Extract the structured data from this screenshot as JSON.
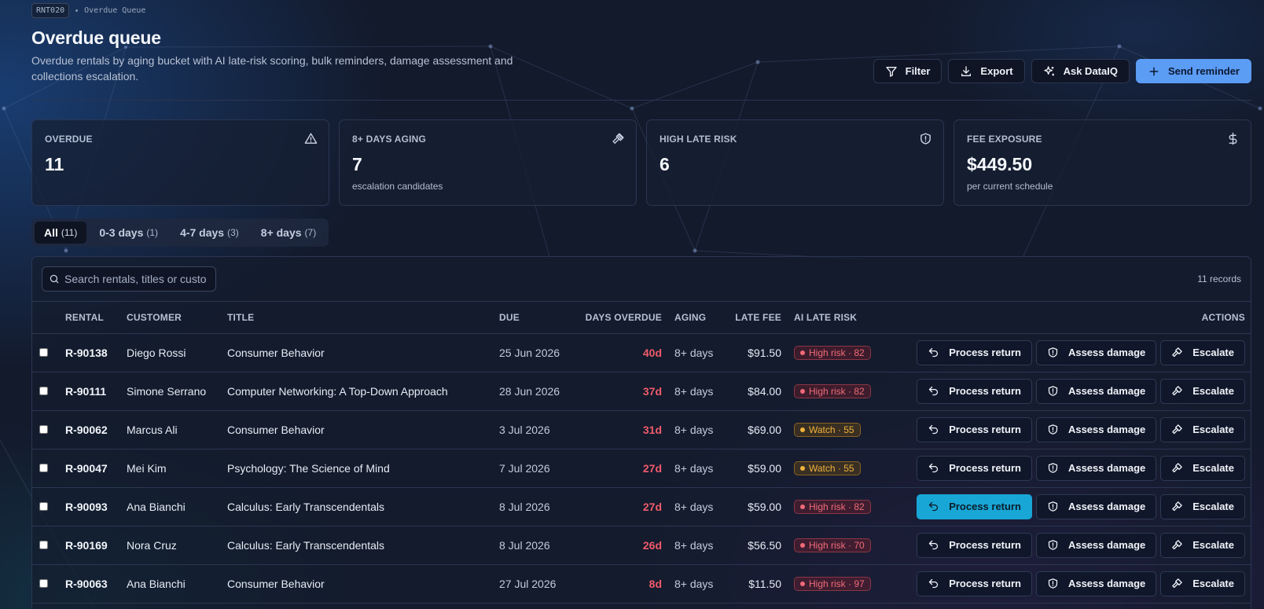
{
  "breadcrumb": {
    "code": "RNT020",
    "label": "Overdue Queue"
  },
  "header": {
    "title": "Overdue queue",
    "subtitle": "Overdue rentals by aging bucket with AI late-risk scoring, bulk reminders, damage assessment and collections escalation."
  },
  "actions": {
    "filter": "Filter",
    "export": "Export",
    "ask": "Ask DataIQ",
    "send": "Send reminder"
  },
  "stats": [
    {
      "label": "OVERDUE",
      "value": "11",
      "sub": "",
      "icon": "alert-triangle-icon"
    },
    {
      "label": "8+ DAYS AGING",
      "value": "7",
      "sub": "escalation candidates",
      "icon": "gavel-icon"
    },
    {
      "label": "HIGH LATE RISK",
      "value": "6",
      "sub": "",
      "icon": "shield-alert-icon"
    },
    {
      "label": "FEE EXPOSURE",
      "value": "$449.50",
      "sub": "per current schedule",
      "icon": "dollar-icon"
    }
  ],
  "tabs": [
    {
      "label": "All",
      "count": "(11)",
      "active": true
    },
    {
      "label": "0-3 days",
      "count": "(1)",
      "active": false
    },
    {
      "label": "4-7 days",
      "count": "(3)",
      "active": false
    },
    {
      "label": "8+ days",
      "count": "(7)",
      "active": false
    }
  ],
  "search": {
    "placeholder": "Search rentals, titles or customers",
    "value": ""
  },
  "records": "11 records",
  "columns": {
    "rental": "RENTAL",
    "customer": "CUSTOMER",
    "title": "TITLE",
    "due": "DUE",
    "days_overdue": "DAYS OVERDUE",
    "aging": "AGING",
    "late_fee": "LATE FEE",
    "ai_risk": "AI LATE RISK",
    "actions": "ACTIONS"
  },
  "row_actions": {
    "process": "Process return",
    "assess": "Assess damage",
    "escalate": "Escalate"
  },
  "rows": [
    {
      "id": "R-90138",
      "customer": "Diego Rossi",
      "title": "Consumer Behavior",
      "due": "25 Jun 2026",
      "days": "40d",
      "aging": "8+ days",
      "fee": "$91.50",
      "risk": "High risk · 82",
      "level": "high"
    },
    {
      "id": "R-90111",
      "customer": "Simone Serrano",
      "title": "Computer Networking: A Top-Down Approach",
      "due": "28 Jun 2026",
      "days": "37d",
      "aging": "8+ days",
      "fee": "$84.00",
      "risk": "High risk · 82",
      "level": "high"
    },
    {
      "id": "R-90062",
      "customer": "Marcus Ali",
      "title": "Consumer Behavior",
      "due": "3 Jul 2026",
      "days": "31d",
      "aging": "8+ days",
      "fee": "$69.00",
      "risk": "Watch · 55",
      "level": "watch"
    },
    {
      "id": "R-90047",
      "customer": "Mei Kim",
      "title": "Psychology: The Science of Mind",
      "due": "7 Jul 2026",
      "days": "27d",
      "aging": "8+ days",
      "fee": "$59.00",
      "risk": "Watch · 55",
      "level": "watch"
    },
    {
      "id": "R-90093",
      "customer": "Ana Bianchi",
      "title": "Calculus: Early Transcendentals",
      "due": "8 Jul 2026",
      "days": "27d",
      "aging": "8+ days",
      "fee": "$59.00",
      "risk": "High risk · 82",
      "level": "high",
      "highlight": true
    },
    {
      "id": "R-90169",
      "customer": "Nora Cruz",
      "title": "Calculus: Early Transcendentals",
      "due": "8 Jul 2026",
      "days": "26d",
      "aging": "8+ days",
      "fee": "$56.50",
      "risk": "High risk · 70",
      "level": "high"
    },
    {
      "id": "R-90063",
      "customer": "Ana Bianchi",
      "title": "Consumer Behavior",
      "due": "27 Jul 2026",
      "days": "8d",
      "aging": "8+ days",
      "fee": "$11.50",
      "risk": "High risk · 97",
      "level": "high"
    }
  ]
}
